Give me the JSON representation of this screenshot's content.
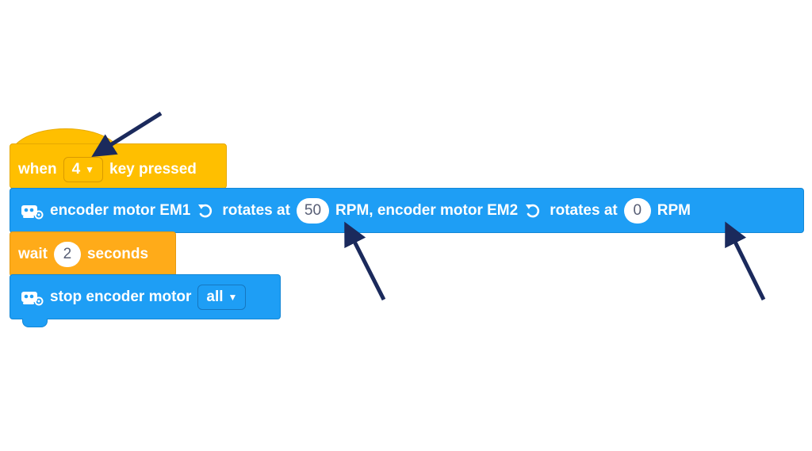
{
  "hat_block": {
    "prefix": "when",
    "key_value": "4",
    "suffix": "key pressed"
  },
  "motor_block": {
    "label1": "encoder motor EM1",
    "rotates1": "rotates at",
    "rpm1": "50",
    "label2": "RPM, encoder motor EM2",
    "rotates2": "rotates at",
    "rpm2": "0",
    "unit": "RPM"
  },
  "wait_block": {
    "prefix": "wait",
    "value": "2",
    "suffix": "seconds"
  },
  "stop_block": {
    "label": "stop encoder motor",
    "selection": "all"
  },
  "icons": {
    "motor": "encoder-motor-icon",
    "rotate": "rotate-ccw-icon",
    "dropdown": "triangle-down-icon",
    "annotation": "arrow-icon"
  },
  "colors": {
    "event_yellow": "#FFBF00",
    "control_orange": "#FFAB19",
    "motor_blue": "#1E9EF5",
    "annotation_navy": "#1B2A5C"
  }
}
